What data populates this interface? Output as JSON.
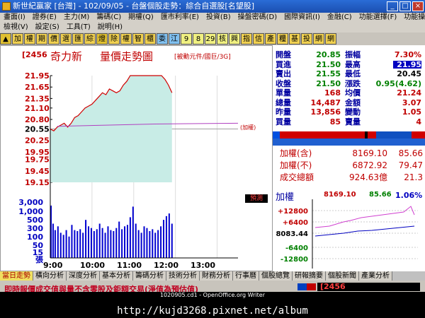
{
  "window": {
    "title": "新世紀贏家 [台灣] - 102/09/05 - 台盤個股走勢：綜合自選股[名望股]"
  },
  "menus": {
    "row1": [
      "畫面(I)",
      "證券(E)",
      "主力(M)",
      "籌碼(C)",
      "期權(Q)",
      "匯市利率(E)",
      "投資(B)",
      "操盤密碼(D)",
      "國際資訊(I)",
      "金融(C)",
      "功能選擇(F)",
      "功能操作(R)"
    ],
    "row2": [
      "檢視(V)",
      "設定(S)",
      "工具(T)",
      "說明(H)"
    ]
  },
  "toolbar": {
    "buttons": [
      "▲",
      "加",
      "權",
      "期",
      "價",
      "選",
      "匯",
      "綜",
      "燈",
      "除",
      "權",
      "智",
      "櫃",
      "委",
      "江",
      "9",
      "8",
      "29",
      "核",
      "興",
      "指",
      "信",
      "產",
      "糧",
      "基",
      "投",
      "網",
      "網"
    ]
  },
  "chart": {
    "code": "[2456",
    "name": "奇力新",
    "chart_title": "量價走勢圖",
    "chart_sub": "[被動元件/國巨/3G]",
    "add_weight_label": "(加權)",
    "forecast_label": "預測"
  },
  "chart_data": {
    "type": "line",
    "price_ticks": [
      "21.95",
      "21.65",
      "21.35",
      "21.10",
      "20.80",
      "20.55",
      "20.25",
      "19.95",
      "19.75",
      "19.45",
      "19.15"
    ],
    "volume_ticks": [
      "3,000",
      "1,000",
      "500",
      "300",
      "100",
      "50",
      "15",
      "張"
    ],
    "x_ticks": [
      "9:00",
      "10:00",
      "11:00",
      "12:00",
      "13:00"
    ],
    "reference_price": 20.55,
    "price_series": [
      [
        0,
        20.55
      ],
      [
        5,
        20.5
      ],
      [
        10,
        20.6
      ],
      [
        15,
        20.65
      ],
      [
        20,
        20.7
      ],
      [
        25,
        20.6
      ],
      [
        30,
        20.7
      ],
      [
        35,
        20.85
      ],
      [
        40,
        20.9
      ],
      [
        45,
        21.0
      ],
      [
        50,
        21.1
      ],
      [
        55,
        21.15
      ],
      [
        60,
        21.2
      ],
      [
        65,
        21.3
      ],
      [
        70,
        21.4
      ],
      [
        75,
        21.5
      ],
      [
        80,
        21.45
      ],
      [
        85,
        21.6
      ],
      [
        90,
        21.55
      ],
      [
        95,
        21.5
      ],
      [
        100,
        21.55
      ],
      [
        105,
        21.7
      ],
      [
        110,
        21.8
      ],
      [
        115,
        21.95
      ],
      [
        120,
        21.95
      ],
      [
        130,
        21.95
      ],
      [
        150,
        21.95
      ],
      [
        160,
        21.95
      ],
      [
        165,
        21.85
      ],
      [
        170,
        21.7
      ],
      [
        175,
        21.5
      ]
    ],
    "volume_series": [
      [
        0,
        2800
      ],
      [
        3,
        400
      ],
      [
        6,
        200
      ],
      [
        10,
        300
      ],
      [
        14,
        150
      ],
      [
        18,
        120
      ],
      [
        22,
        200
      ],
      [
        26,
        100
      ],
      [
        30,
        350
      ],
      [
        34,
        200
      ],
      [
        38,
        180
      ],
      [
        42,
        220
      ],
      [
        46,
        150
      ],
      [
        50,
        600
      ],
      [
        54,
        300
      ],
      [
        58,
        250
      ],
      [
        62,
        180
      ],
      [
        66,
        220
      ],
      [
        70,
        400
      ],
      [
        74,
        250
      ],
      [
        78,
        150
      ],
      [
        82,
        300
      ],
      [
        86,
        200
      ],
      [
        90,
        180
      ],
      [
        94,
        250
      ],
      [
        98,
        500
      ],
      [
        102,
        220
      ],
      [
        106,
        300
      ],
      [
        110,
        350
      ],
      [
        114,
        800
      ],
      [
        118,
        2500
      ],
      [
        122,
        400
      ],
      [
        126,
        200
      ],
      [
        130,
        150
      ],
      [
        134,
        300
      ],
      [
        138,
        250
      ],
      [
        142,
        180
      ],
      [
        146,
        220
      ],
      [
        150,
        150
      ],
      [
        154,
        200
      ],
      [
        158,
        300
      ],
      [
        162,
        600
      ],
      [
        166,
        900
      ],
      [
        170,
        1200
      ],
      [
        174,
        400
      ]
    ]
  },
  "quote": {
    "rows": [
      {
        "l1": "開盤",
        "v1": "20.85",
        "l2": "振幅",
        "v2": "7.30%"
      },
      {
        "l1": "買進",
        "v1": "21.50",
        "l2": "最高",
        "v2": "21.95"
      },
      {
        "l1": "賣出",
        "v1": "21.55",
        "l2": "最低",
        "v2": "20.45"
      },
      {
        "l1": "收盤",
        "v1": "21.50",
        "l2": "漲跌",
        "v2": "0.95(4.62)"
      },
      {
        "l1": "單量",
        "v1": "168",
        "l2": "均價",
        "v2": "21.24"
      },
      {
        "l1": "總量",
        "v1": "14,487",
        "l2": "金額",
        "v2": "3.07"
      },
      {
        "l1": "昨量",
        "v1": "13,856",
        "l2": "變動",
        "v2": "1.05"
      },
      {
        "l1": "買量",
        "v1": "85",
        "l2": "賣量",
        "v2": "4"
      }
    ],
    "indices": [
      {
        "label": "加權(含)",
        "value": "8169.10",
        "change": "85.66"
      },
      {
        "label": "加權(不)",
        "value": "6872.92",
        "change": "79.47"
      },
      {
        "label": "成交總額",
        "value": "924.63億",
        "change": "21.3"
      }
    ]
  },
  "mini_chart": {
    "label": "加權",
    "value": "8169.10",
    "change": "85.66",
    "pct": "1.06%",
    "y_ticks": [
      "+12800",
      "+6400",
      "8083.44",
      "-6400",
      "-12800"
    ]
  },
  "tabs": [
    "當日走勢",
    "橫向分析",
    "深度分析",
    "基本分析",
    "籌碼分析",
    "技術分析",
    "財務分析",
    "行事曆",
    "個股總覽",
    "研報摘要",
    "個股新聞",
    "產業分析"
  ],
  "status": {
    "message": "即時報價成交值與量不含零股及鉅額交易(淨值為預估值)",
    "code_box": "[2456"
  },
  "watermark": {
    "small": "1020905.cd1 - OpenOffice.org Writer",
    "url": "http://kujd3268.pixnet.net/album"
  }
}
